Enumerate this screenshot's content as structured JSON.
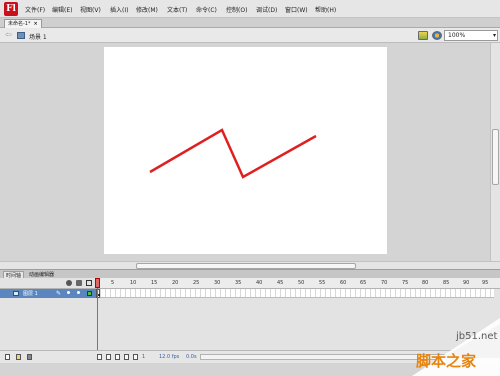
{
  "app": {
    "logo_letter": "Fl"
  },
  "menu": [
    "文件(F)",
    "编辑(E)",
    "视图(V)",
    "插入(I)",
    "修改(M)",
    "文本(T)",
    "命令(C)",
    "控制(O)",
    "调试(D)",
    "窗口(W)",
    "帮助(H)"
  ],
  "document_tab": {
    "title": "未命名-1*",
    "close": "×"
  },
  "editbar": {
    "back": "⇦",
    "scene_label": "场景 1",
    "zoom_value": "100%",
    "zoom_chevron": "▾"
  },
  "stage": {
    "stroke_color": "#e02020",
    "background": "#ffffff"
  },
  "panel_tabs": [
    "时间轴",
    "动画编辑器"
  ],
  "timeline": {
    "frame_numbers": [
      "5",
      "10",
      "15",
      "20",
      "25",
      "30",
      "35",
      "40",
      "45",
      "50",
      "55",
      "60",
      "65",
      "70",
      "75",
      "80",
      "85",
      "90",
      "95"
    ],
    "layer_name": "图层 1",
    "footer": {
      "current_frame": "1",
      "fps": "12.0 fps",
      "elapsed": "0.0s"
    }
  },
  "watermark": {
    "url": "jb51.net",
    "text": "脚本之家"
  }
}
